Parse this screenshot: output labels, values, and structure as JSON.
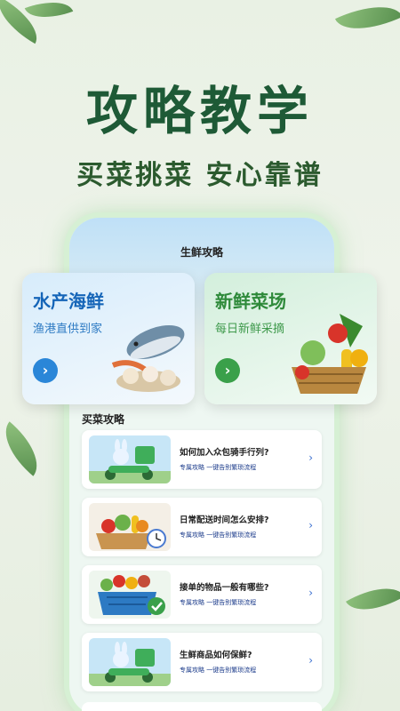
{
  "hero": {
    "title": "攻略教学",
    "subtitle": "买菜挑菜 安心靠谱"
  },
  "screen": {
    "title": "生鲜攻略"
  },
  "cards": [
    {
      "title": "水产海鲜",
      "subtitle": "渔港直供到家",
      "button": "›",
      "icon": "seafood-illustration"
    },
    {
      "title": "新鲜菜场",
      "subtitle": "每日新鲜采摘",
      "button": "›",
      "icon": "vegetable-basket-illustration"
    }
  ],
  "section": {
    "title": "买菜攻略"
  },
  "items": [
    {
      "question": "如何加入众包骑手行列?",
      "desc": "专属攻略 一键告别繁琐流程",
      "arrow": "›",
      "icon": "rider-bunny-illustration"
    },
    {
      "question": "日常配送时间怎么安排?",
      "desc": "专属攻略 一键告别繁琐流程",
      "arrow": "›",
      "icon": "vegetable-clock-illustration"
    },
    {
      "question": "接单的物品一般有哪些?",
      "desc": "专属攻略 一键告别繁琐流程",
      "arrow": "›",
      "icon": "grocery-basket-check-illustration"
    },
    {
      "question": "生鲜商品如何保鲜?",
      "desc": "专属攻略 一键告别繁琐流程",
      "arrow": "›",
      "icon": "rider-bunny-illustration"
    }
  ],
  "colors": {
    "heroTitle": "#1e5a36",
    "blueAccent": "#2a86d8",
    "greenAccent": "#3aa04a",
    "linkBlue": "#3a6fd0"
  }
}
